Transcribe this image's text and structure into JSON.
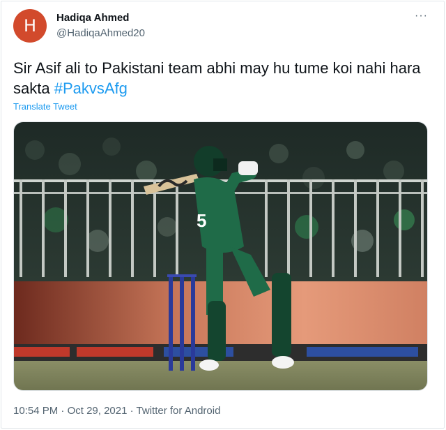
{
  "author": {
    "avatar_letter": "H",
    "avatar_color": "#d24a2c",
    "display_name": "Hadiqa Ahmed",
    "handle": "@HadiqaAhmed20"
  },
  "more_label": "···",
  "tweet": {
    "text": "Sir Asif ali to Pakistani team abhi may hu tume koi nahi hara sakta ",
    "hashtag": "#PakvsAfg",
    "translate_label": "Translate Tweet"
  },
  "media": {
    "jersey_number": "5"
  },
  "meta": {
    "time": "10:54 PM",
    "sep1": " · ",
    "date": "Oct 29, 2021",
    "sep2": " · ",
    "source": "Twitter for Android"
  },
  "colors": {
    "link": "#1d9bf0",
    "secondary_text": "#536471",
    "jersey_green": "#1f6b48"
  }
}
